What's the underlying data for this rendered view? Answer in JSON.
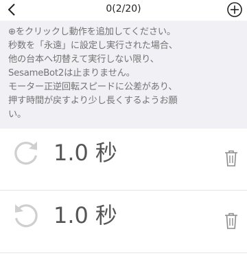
{
  "header": {
    "back_icon": "chevron-left-icon",
    "title": "0(2/20)",
    "add_icon": "circle-plus-icon"
  },
  "notice": {
    "text": "⊕をクリックし動作を追加してください。\n秒数を「永遠」に設定し実行された場合、\n他の台本へ切替えて実行しない限り、\nSesameBot2は止まりません。\nモーター正逆回転スピードに公差があり、\n押す時間が戻すより少し長くするようお願\nい。"
  },
  "actions": [
    {
      "direction_icon": "rotate-clockwise-icon",
      "value": "1.0",
      "unit": "秒",
      "delete_icon": "trash-icon"
    },
    {
      "direction_icon": "rotate-counterclockwise-icon",
      "value": "1.0",
      "unit": "秒",
      "delete_icon": "trash-icon"
    }
  ],
  "colors": {
    "notice_bg": "#f1f0f5",
    "notice_text": "#737373",
    "icon_gray": "#cfcfcf",
    "value_text": "#555555"
  }
}
